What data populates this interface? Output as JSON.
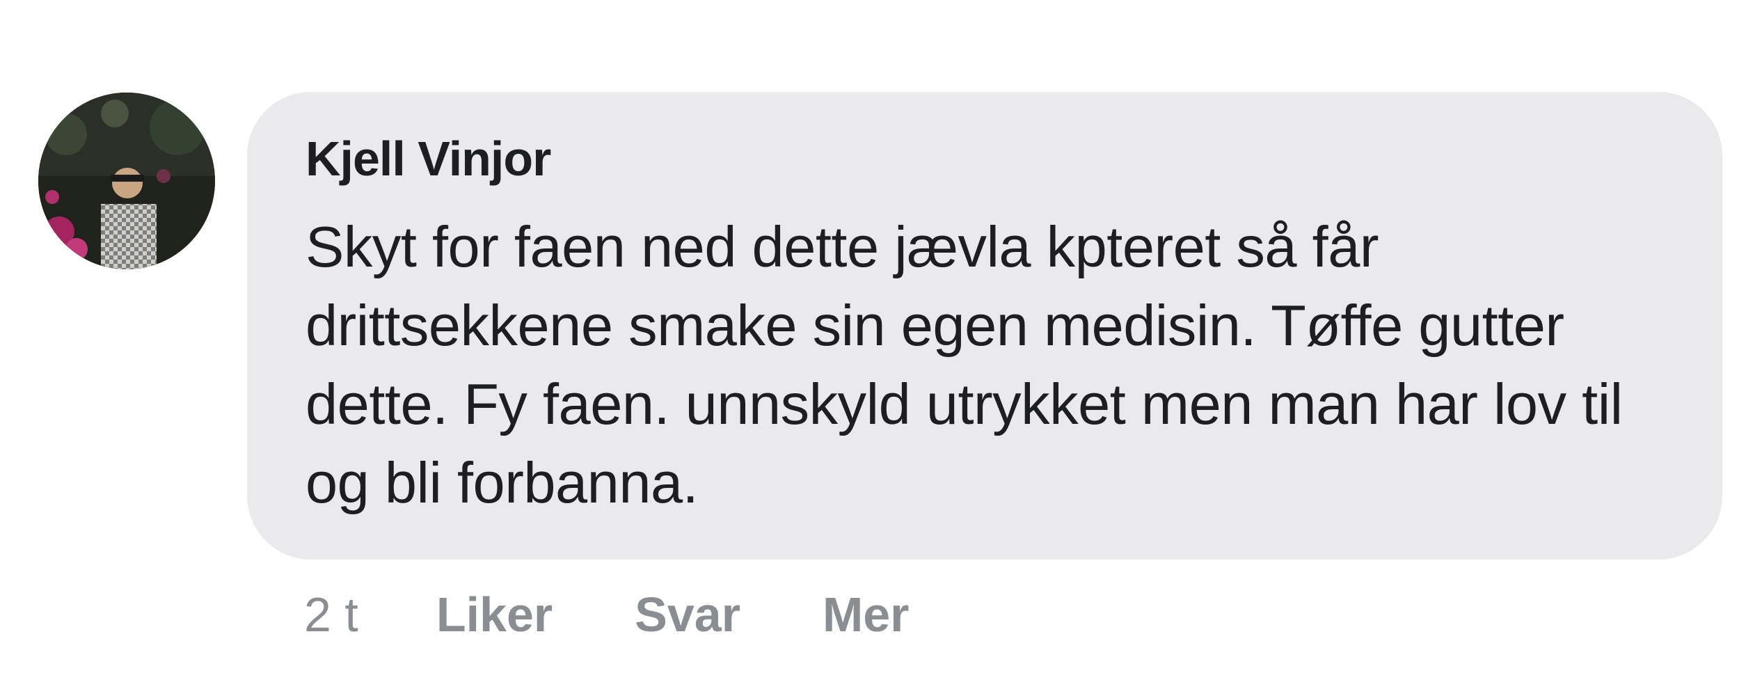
{
  "comment": {
    "author": "Kjell Vinjor",
    "text": "Skyt for faen ned dette jævla kpteret så får drittsekkene smake sin egen medisin. Tøffe gutter dette. Fy faen. unnskyld utrykket men man har lov til og bli forbanna.",
    "time": "2 t",
    "actions": {
      "like": "Liker",
      "reply": "Svar",
      "more": "Mer"
    }
  },
  "colors": {
    "bubble": "#eaeaec",
    "text": "#1c1e21",
    "meta": "#8a8d91"
  }
}
